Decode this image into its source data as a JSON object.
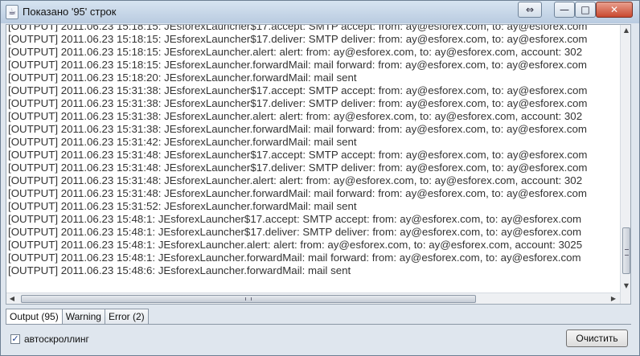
{
  "window": {
    "title": "Показано '95' строк",
    "controls": {
      "swap": "⇔",
      "minimize": "—",
      "maximize": "□",
      "close": "✕"
    }
  },
  "log": {
    "lines": [
      "[OUTPUT] 2011.06.23 15:18:15: JEsforexLauncher$17.accept: SMTP accept: from: ay@esforex.com, to: ay@esforex.com",
      "[OUTPUT] 2011.06.23 15:18:15: JEsforexLauncher$17.deliver: SMTP deliver: from: ay@esforex.com, to: ay@esforex.com",
      "[OUTPUT] 2011.06.23 15:18:15: JEsforexLauncher.alert: alert: from: ay@esforex.com, to: ay@esforex.com, account: 302",
      "[OUTPUT] 2011.06.23 15:18:15: JEsforexLauncher.forwardMail: mail forward: from: ay@esforex.com, to: ay@esforex.com",
      "[OUTPUT] 2011.06.23 15:18:20: JEsforexLauncher.forwardMail: mail sent",
      "[OUTPUT] 2011.06.23 15:31:38: JEsforexLauncher$17.accept: SMTP accept: from: ay@esforex.com, to: ay@esforex.com",
      "[OUTPUT] 2011.06.23 15:31:38: JEsforexLauncher$17.deliver: SMTP deliver: from: ay@esforex.com, to: ay@esforex.com",
      "[OUTPUT] 2011.06.23 15:31:38: JEsforexLauncher.alert: alert: from: ay@esforex.com, to: ay@esforex.com, account: 302",
      "[OUTPUT] 2011.06.23 15:31:38: JEsforexLauncher.forwardMail: mail forward: from: ay@esforex.com, to: ay@esforex.com",
      "[OUTPUT] 2011.06.23 15:31:42: JEsforexLauncher.forwardMail: mail sent",
      "[OUTPUT] 2011.06.23 15:31:48: JEsforexLauncher$17.accept: SMTP accept: from: ay@esforex.com, to: ay@esforex.com",
      "[OUTPUT] 2011.06.23 15:31:48: JEsforexLauncher$17.deliver: SMTP deliver: from: ay@esforex.com, to: ay@esforex.com",
      "[OUTPUT] 2011.06.23 15:31:48: JEsforexLauncher.alert: alert: from: ay@esforex.com, to: ay@esforex.com, account: 302",
      "[OUTPUT] 2011.06.23 15:31:48: JEsforexLauncher.forwardMail: mail forward: from: ay@esforex.com, to: ay@esforex.com",
      "[OUTPUT] 2011.06.23 15:31:52: JEsforexLauncher.forwardMail: mail sent",
      "[OUTPUT] 2011.06.23 15:48:1: JEsforexLauncher$17.accept: SMTP accept: from: ay@esforex.com, to: ay@esforex.com",
      "[OUTPUT] 2011.06.23 15:48:1: JEsforexLauncher$17.deliver: SMTP deliver: from: ay@esforex.com, to: ay@esforex.com",
      "[OUTPUT] 2011.06.23 15:48:1: JEsforexLauncher.alert: alert: from: ay@esforex.com, to: ay@esforex.com, account: 3025",
      "[OUTPUT] 2011.06.23 15:48:1: JEsforexLauncher.forwardMail: mail forward: from: ay@esforex.com, to: ay@esforex.com",
      "[OUTPUT] 2011.06.23 15:48:6: JEsforexLauncher.forwardMail: mail sent"
    ]
  },
  "tabs": [
    {
      "label": "Output (95)",
      "active": true
    },
    {
      "label": "Warning",
      "active": false
    },
    {
      "label": "Error (2)",
      "active": false
    }
  ],
  "footer": {
    "autoscroll_label": "автоскроллинг",
    "autoscroll_checked": true,
    "clear_label": "Очистить"
  }
}
